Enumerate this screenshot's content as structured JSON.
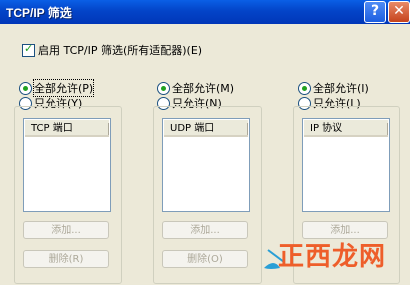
{
  "window": {
    "title": "TCP/IP 筛选",
    "help_label": "?",
    "close_label": "✕"
  },
  "enable_all": {
    "label": "启用 TCP/IP 筛选(所有适配器)(E)",
    "checked": true
  },
  "columns": [
    {
      "allow_all_label": "全部允许(P)",
      "allow_only_label": "只允许(Y)",
      "selected": "allow_all",
      "list_header": "TCP 端口",
      "add_label": "添加...",
      "remove_label": "删除(R)"
    },
    {
      "allow_all_label": "全部允许(M)",
      "allow_only_label": "只允许(N)",
      "selected": "allow_all",
      "list_header": "UDP 端口",
      "add_label": "添加...",
      "remove_label": "删除(O)"
    },
    {
      "allow_all_label": "全部允许(I)",
      "allow_only_label": "只允许(L)",
      "selected": "allow_all",
      "list_header": "IP 协议",
      "add_label": "添加...",
      "remove_label": ""
    }
  ],
  "watermark": {
    "text": "正西龙网"
  },
  "colors": {
    "titlebar": "#0344c8",
    "dialog_bg": "#ece9d8",
    "check_green": "#21a121",
    "watermark_orange": "#ee5e2a"
  }
}
